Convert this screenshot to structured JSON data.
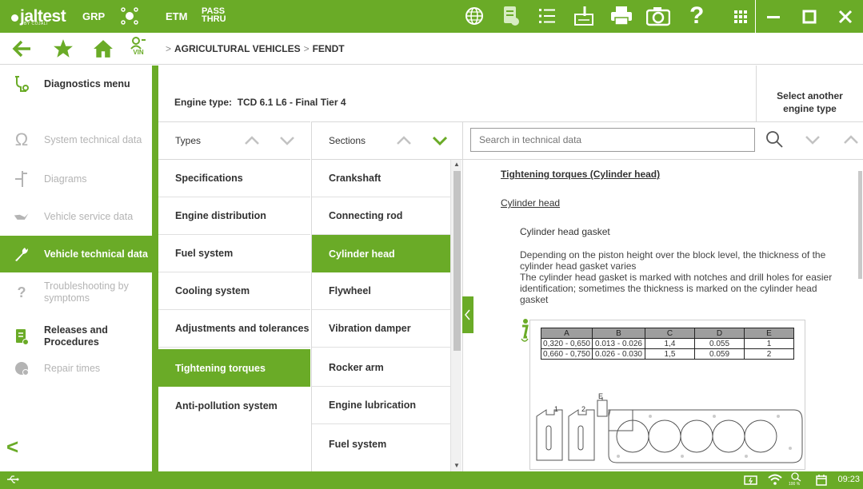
{
  "colors": {
    "brand": "#6aab27",
    "text": "#333333",
    "disabled": "#b4b4b4"
  },
  "topbar": {
    "logo": "jaltest",
    "logo_sub": "BY COJALI",
    "grp_label": "GRP",
    "etm_label": "ETM",
    "pass_label": "PASS",
    "thru_label": "THRU",
    "icons": [
      "globe-icon",
      "report-icon",
      "list-icon",
      "sign-icon",
      "printer-icon",
      "camera-icon",
      "help-icon",
      "apps-icon"
    ],
    "help_glyph": "?"
  },
  "navbar": {
    "vin_label": "VIN",
    "breadcrumb": [
      {
        "label": "AGRICULTURAL VEHICLES"
      },
      {
        "label": "FENDT"
      }
    ],
    "separator": ">"
  },
  "sidebar": {
    "items": [
      {
        "label": "Diagnostics menu",
        "icon": "diagnostics-icon",
        "state": "normal"
      },
      {
        "label": "System technical data",
        "icon": "omega-icon",
        "state": "disabled"
      },
      {
        "label": "Diagrams",
        "icon": "diagram-icon",
        "state": "disabled"
      },
      {
        "label": "Vehicle service data",
        "icon": "oil-can-icon",
        "state": "disabled"
      },
      {
        "label": "Vehicle technical data",
        "icon": "wrench-icon",
        "state": "active"
      },
      {
        "label": "Troubleshooting by symptoms",
        "icon": "troubleshoot-icon",
        "state": "disabled"
      },
      {
        "label": "Releases and Procedures",
        "icon": "procedures-icon",
        "state": "normal"
      },
      {
        "label": "Repair times",
        "icon": "clock-icon",
        "state": "disabled"
      }
    ],
    "back_glyph": "<"
  },
  "engine": {
    "label": "Engine type:",
    "value": "TCD 6.1 L6 - Final Tier 4",
    "select_line1": "Select another",
    "select_line2": "engine type"
  },
  "types": {
    "header": "Types",
    "items": [
      {
        "label": "Specifications",
        "active": false
      },
      {
        "label": "Engine distribution",
        "active": false
      },
      {
        "label": "Fuel system",
        "active": false
      },
      {
        "label": "Cooling system",
        "active": false
      },
      {
        "label": "Adjustments and tolerances",
        "active": false
      },
      {
        "label": "Tightening torques",
        "active": true
      },
      {
        "label": "Anti-pollution system",
        "active": false
      }
    ]
  },
  "sections": {
    "header": "Sections",
    "items": [
      {
        "label": "Crankshaft",
        "active": false
      },
      {
        "label": "Connecting rod",
        "active": false
      },
      {
        "label": "Cylinder head",
        "active": true
      },
      {
        "label": "Flywheel",
        "active": false
      },
      {
        "label": "Vibration damper",
        "active": false
      },
      {
        "label": "Rocker arm",
        "active": false
      },
      {
        "label": "Engine lubrication",
        "active": false
      },
      {
        "label": "Fuel system",
        "active": false
      }
    ]
  },
  "search": {
    "placeholder": "Search in technical data"
  },
  "content": {
    "title": "Tightening torques (Cylinder head)",
    "subtitle": "Cylinder head",
    "gasket": "Cylinder head gasket",
    "body1": "Depending on the piston height over the block level, the thickness of the cylinder head gasket varies",
    "body2": "The cylinder head gasket is marked with notches and drill holes for easier identification; sometimes the thickness is marked on the cylinder head gasket",
    "table": {
      "headers": [
        "A",
        "B",
        "C",
        "D",
        "E"
      ],
      "rows": [
        [
          "0,320 - 0,650",
          "0.013 - 0.026",
          "1,4",
          "0.055",
          "1"
        ],
        [
          "0,660 - 0,750",
          "0.026 - 0.030",
          "1,5",
          "0.059",
          "2"
        ]
      ]
    },
    "diagram_labels": {
      "e": "E",
      "one": "1",
      "two": "2"
    }
  },
  "statusbar": {
    "time": "09:23",
    "zoom": "100 %"
  }
}
